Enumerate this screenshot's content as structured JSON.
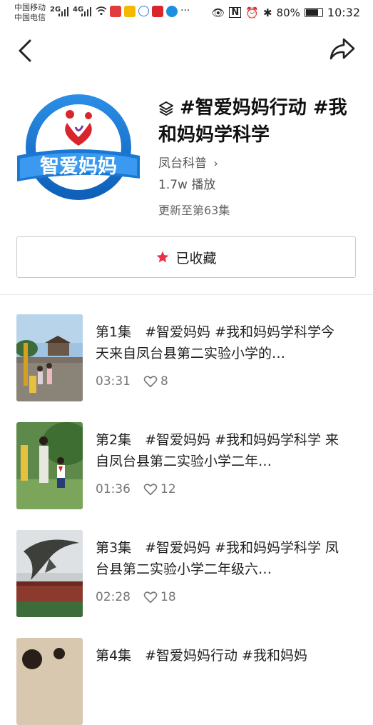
{
  "status_bar": {
    "carrier1": "中国移动",
    "carrier2": "中国电信",
    "signal1": "2G",
    "signal2": "4G",
    "battery": "80%",
    "battery_level": 0.8,
    "time": "10:32"
  },
  "album": {
    "title": "#智爱妈妈行动 #我和妈妈学科学",
    "logo_text": "智爱妈妈",
    "author": "凤台科普",
    "plays": "1.7w 播放",
    "updated": "更新至第63集",
    "collect_label": "已收藏"
  },
  "episodes": [
    {
      "text": "第1集　#智爱妈妈 #我和妈妈学科学今天来自凤台县第二实验小学的…",
      "duration": "03:31",
      "likes": "8"
    },
    {
      "text": "第2集　#智爱妈妈 #我和妈妈学科学 来自凤台县第二实验小学二年…",
      "duration": "01:36",
      "likes": "12"
    },
    {
      "text": "第3集　#智爱妈妈 #我和妈妈学科学 凤台县第二实验小学二年级六…",
      "duration": "02:28",
      "likes": "18"
    },
    {
      "text": "第4集　#智爱妈妈行动 #我和妈妈",
      "duration": "",
      "likes": ""
    }
  ],
  "colors": {
    "accent_red": "#e8334a",
    "logo_blue": "#1a78d2"
  }
}
